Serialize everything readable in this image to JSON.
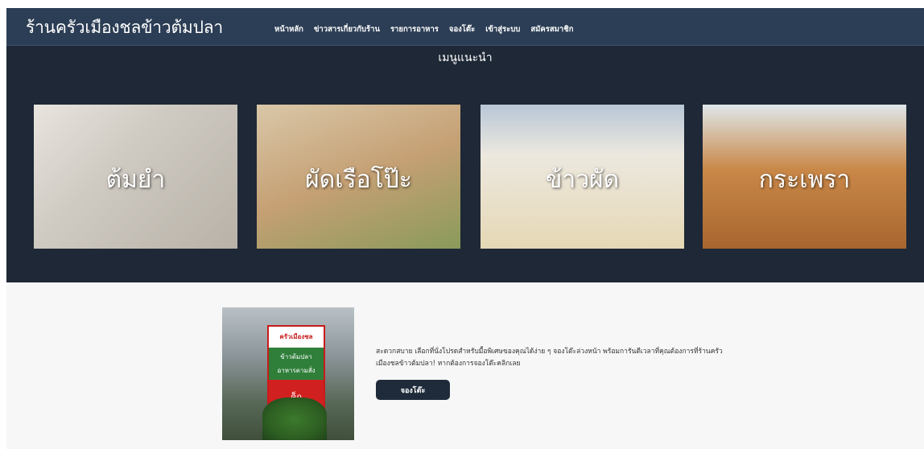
{
  "navbar": {
    "brand": "ร้านครัวเมืองชลข้าวต้มปลา",
    "links": [
      "หน้าหลัก",
      "ข่าวสารเกี่ยวกับร้าน",
      "รายการอาหาร",
      "จองโต๊ะ",
      "เข้าสู่ระบบ",
      "สมัครสมาชิก"
    ]
  },
  "hero": {
    "title": "เมนูแนะนำ",
    "cards": [
      {
        "caption": "ต้มยำ"
      },
      {
        "caption": "ผัดเรือโป๊ะ"
      },
      {
        "caption": "ข้าวผัด"
      },
      {
        "caption": "กระเพรา"
      }
    ]
  },
  "booking": {
    "description": "สะดวกสบาย เลือกที่นั่งโปรดสำหรับมื้อพิเศษของคุณได้ง่าย ๆ จองโต๊ะล่วงหน้า พร้อมการันตีเวลาที่คุณต้องการที่ร้านครัวเมืองชลข้าวต้มปลา! หากต้องการจองโต๊ะคลิกเลย",
    "button_label": "จองโต๊ะ",
    "sign": {
      "line1": "ครัวเมืองชล",
      "line2": "ข้าวต้มปลา",
      "line3": "อาหารตามสั่ง",
      "line4": "ค็ก"
    }
  },
  "colors": {
    "navbar_bg": "#2c3e55",
    "hero_bg": "#1e2836",
    "button_bg": "#1f2b3a"
  }
}
